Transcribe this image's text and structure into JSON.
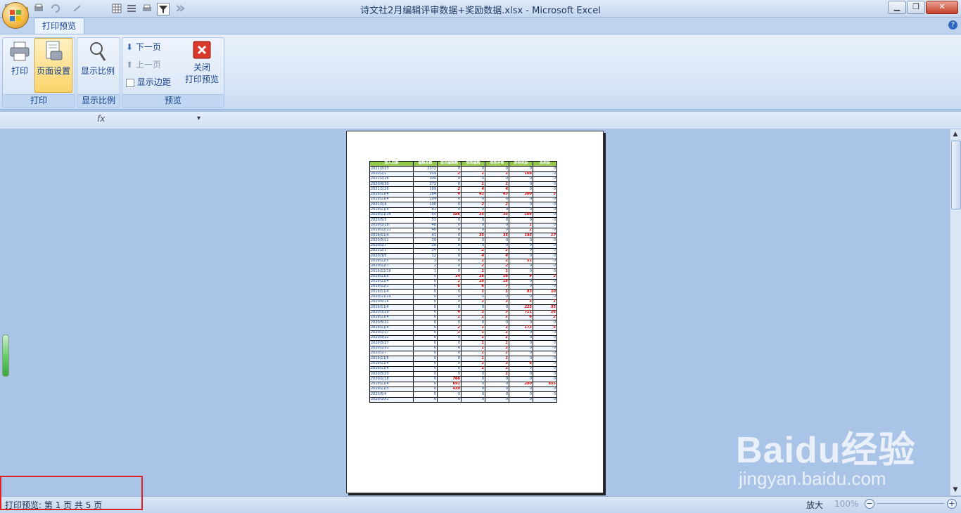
{
  "window": {
    "title": "诗文社2月编辑评审数据+奖励数据.xlsx - Microsoft Excel",
    "controls": [
      "minimize",
      "restore",
      "close"
    ]
  },
  "ribbon": {
    "tab": "打印预览",
    "groups": {
      "print": {
        "label": "打印",
        "print_button": "打印",
        "page_setup_button": "页面设置"
      },
      "zoom": {
        "label": "显示比例",
        "zoom_button": "显示比例"
      },
      "preview": {
        "label": "预览",
        "next_page": "下一页",
        "prev_page": "上一页",
        "show_margins": "显示边距",
        "close_line1": "关闭",
        "close_line2": "打印预览"
      }
    }
  },
  "quick_access": [
    "save-icon",
    "open-icon",
    "print-preview-icon",
    "undo-icon",
    "redo-icon",
    "fx-icon",
    "grid-icon",
    "rows-icon",
    "print-icon",
    "filter-icon",
    "sort-icon",
    "more-icon"
  ],
  "sheet": {
    "headers": [
      "加入日期",
      "编辑总数",
      "首次编辑数",
      "有效编辑",
      "有效评审",
      "获得奖励",
      "总奖励"
    ],
    "rows": [
      [
        "2021/2/23",
        "2372",
        "0",
        "0",
        "0",
        "0",
        "0"
      ],
      [
        "2020/2/1",
        "559",
        "2",
        "1",
        "1",
        "108",
        "0"
      ],
      [
        "2021/2/26",
        "394",
        "0",
        "0",
        "0",
        "0",
        "0"
      ],
      [
        "2020/6/30",
        "273",
        "0",
        "1",
        "1",
        "0",
        "0"
      ],
      [
        "2021/1/26",
        "209",
        "2",
        "4",
        "4",
        "0",
        "0"
      ],
      [
        "2019/11/4",
        "164",
        "4",
        "43",
        "43",
        "200",
        "5"
      ],
      [
        "2019/11/4",
        "109",
        "0",
        "0",
        "0",
        "0",
        "0"
      ],
      [
        "2021/1/4",
        "100",
        "0",
        "2",
        "2",
        "0",
        "0"
      ],
      [
        "2019/11/4",
        "81",
        "0",
        "0",
        "0",
        "0",
        "0"
      ],
      [
        "2019/11/14",
        "55",
        "186",
        "35",
        "35",
        "108",
        "0"
      ],
      [
        "2020/5/3",
        "51",
        "0",
        "0",
        "0",
        "0",
        "0"
      ],
      [
        "2020/1/18",
        "48",
        "0",
        "0",
        "0",
        "1",
        "0"
      ],
      [
        "2019/12/11",
        "46",
        "0",
        "0",
        "0",
        "2",
        "0"
      ],
      [
        "2019/11/4",
        "41",
        "0",
        "35",
        "35",
        "195",
        "17"
      ],
      [
        "2020/5/11",
        "39",
        "0",
        "0",
        "0",
        "0",
        "0"
      ],
      [
        "2020/1/7",
        "28",
        "0",
        "0",
        "0",
        "0",
        "0"
      ],
      [
        "2021/2/1",
        "24",
        "0",
        "2",
        "2",
        "0",
        "0"
      ],
      [
        "2020/3/5",
        "12",
        "0",
        "4",
        "4",
        "0",
        "0"
      ],
      [
        "2019/12/5",
        "3",
        "0",
        "1",
        "1",
        "51",
        "0"
      ],
      [
        "2020/12/7",
        "2",
        "0",
        "2",
        "2",
        "0",
        "0"
      ],
      [
        "2019/12/10",
        "1",
        "0",
        "1",
        "1",
        "0",
        "0"
      ],
      [
        "2019/11/5",
        "0",
        "14",
        "16",
        "16",
        "4",
        "2"
      ],
      [
        "2019/11/4",
        "0",
        "1",
        "18",
        "18",
        "0",
        "0"
      ],
      [
        "2019/12/1",
        "0",
        "6",
        "6",
        "7",
        "0",
        "0"
      ],
      [
        "2019/11/4",
        "0",
        "0",
        "1",
        "1",
        "83",
        "10"
      ],
      [
        "2020/11/20",
        "0",
        "0",
        "0",
        "0",
        "0",
        "0"
      ],
      [
        "2020/5/14",
        "0",
        "0",
        "1",
        "1",
        "5",
        "1"
      ],
      [
        "2019/11/4",
        "0",
        "0",
        "0",
        "0",
        "225",
        "55"
      ],
      [
        "2020/3/29",
        "0",
        "4",
        "3",
        "3",
        "711",
        "26"
      ],
      [
        "2019/11/4",
        "0",
        "1",
        "1",
        "1",
        "6",
        "2"
      ],
      [
        "2020/5/22",
        "0",
        "0",
        "0",
        "0",
        "0",
        "0"
      ],
      [
        "2019/11/4",
        "0",
        "2",
        "1",
        "1",
        "173",
        "5"
      ],
      [
        "2020/1/17",
        "0",
        "1",
        "1",
        "1",
        "0",
        "0"
      ],
      [
        "2020/5/22",
        "0",
        "0",
        "1",
        "1",
        "0",
        "0"
      ],
      [
        "2020/5/27",
        "0",
        "0",
        "1",
        "1",
        "0",
        "0"
      ],
      [
        "2020/1/31",
        "0",
        "0",
        "1",
        "1",
        "0",
        "0"
      ],
      [
        "2020/1/7",
        "0",
        "0",
        "1",
        "1",
        "0",
        "0"
      ],
      [
        "2019/11/5",
        "0",
        "0",
        "1",
        "1",
        "0",
        "0"
      ],
      [
        "2019/11/4",
        "0",
        "0",
        "1",
        "1",
        "6",
        "0"
      ],
      [
        "2019/11/4",
        "0",
        "0",
        "1",
        "1",
        "0",
        "0"
      ],
      [
        "2020/5/20",
        "0",
        "0",
        "0",
        "1",
        "0",
        "0"
      ],
      [
        "2020/1/18",
        "0",
        "766",
        "0",
        "0",
        "0",
        "0"
      ],
      [
        "2019/11/4",
        "0",
        "691",
        "0",
        "0",
        "280",
        "655"
      ],
      [
        "2019/11/5",
        "0",
        "439",
        "0",
        "0",
        "0",
        "0"
      ],
      [
        "2020/5/4",
        "0",
        "0",
        "0",
        "0",
        "0",
        "0"
      ],
      [
        "2020/10/1",
        "0",
        "0",
        "0",
        "0",
        "0",
        "0"
      ]
    ],
    "red_threshold_note": ""
  },
  "status": {
    "text": "打印预览: 第 1 页  共 5 页",
    "zoom_in_label": "放大",
    "zoom_level": "100%",
    "zoom_minus": "−",
    "zoom_plus": "+"
  },
  "watermark": {
    "main": "Baidu经验",
    "url": "jingyan.baidu.com"
  },
  "colors": {
    "accent": "#15428b",
    "header_green": "#92c94b",
    "red_value": "#e00000",
    "highlight_box": "#e02020"
  }
}
